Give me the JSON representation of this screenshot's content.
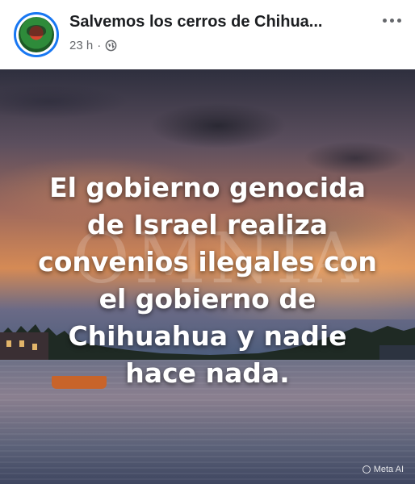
{
  "post": {
    "page_name": "Salvemos los cerros de Chihua...",
    "time": "23 h",
    "separator": "·",
    "privacy_icon": "globe-icon",
    "more_icon": "more-options-icon"
  },
  "image": {
    "headline": "El gobierno genocida\nde Israel realiza\nconvenios ilegales con\nel gobierno de\nChihuahua y nadie\nhace nada.",
    "watermark": "OMNIA",
    "ai_badge": "Meta AI"
  },
  "colors": {
    "accent": "#1877f2",
    "secondary_text": "#65676b",
    "primary_text": "#1c1e21"
  }
}
